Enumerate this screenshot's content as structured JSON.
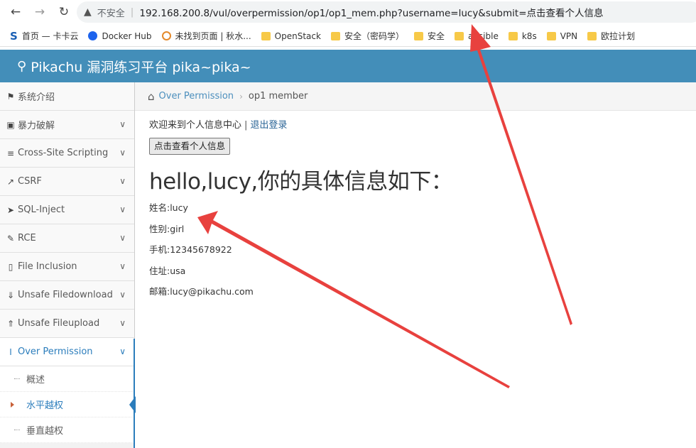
{
  "browser": {
    "insecure_label": "不安全",
    "url": "192.168.200.8/vul/overpermission/op1/op1_mem.php?username=lucy&submit=点击查看个人信息",
    "bookmarks": [
      {
        "label": "首页 — 卡卡云",
        "icon": "s-logo-icon"
      },
      {
        "label": "Docker Hub",
        "icon": "docker-icon"
      },
      {
        "label": "未找到页面 | 秋水...",
        "icon": "ring-icon"
      },
      {
        "label": "OpenStack",
        "icon": "folder-icon"
      },
      {
        "label": "安全（密码学）",
        "icon": "folder-icon"
      },
      {
        "label": "安全",
        "icon": "folder-icon"
      },
      {
        "label": "ansible",
        "icon": "folder-icon"
      },
      {
        "label": "k8s",
        "icon": "folder-icon"
      },
      {
        "label": "VPN",
        "icon": "folder-icon"
      },
      {
        "label": "欧拉计划",
        "icon": "folder-icon"
      }
    ]
  },
  "header": {
    "title": "Pikachu 漏洞练习平台 pika~pika~"
  },
  "sidebar": {
    "items": [
      {
        "label": "系统介绍",
        "icon": "tag-icon",
        "has_chevron": false
      },
      {
        "label": "暴力破解",
        "icon": "lock-icon",
        "has_chevron": true
      },
      {
        "label": "Cross-Site Scripting",
        "icon": "code-icon",
        "has_chevron": true
      },
      {
        "label": "CSRF",
        "icon": "share-icon",
        "has_chevron": true
      },
      {
        "label": "SQL-Inject",
        "icon": "plane-icon",
        "has_chevron": true
      },
      {
        "label": "RCE",
        "icon": "pencil-icon",
        "has_chevron": true
      },
      {
        "label": "File Inclusion",
        "icon": "file-icon",
        "has_chevron": true
      },
      {
        "label": "Unsafe Filedownload",
        "icon": "download-icon",
        "has_chevron": true
      },
      {
        "label": "Unsafe Fileupload",
        "icon": "upload-icon",
        "has_chevron": true
      },
      {
        "label": "Over Permission",
        "icon": "text-cursor-icon",
        "has_chevron": true
      }
    ],
    "sub_items": [
      {
        "label": "概述"
      },
      {
        "label": "水平越权"
      },
      {
        "label": "垂直越权"
      }
    ]
  },
  "breadcrumb": {
    "parent": "Over Permission",
    "current": "op1 member"
  },
  "main": {
    "welcome_text": "欢迎来到个人信息中心",
    "logout_label": "退出登录",
    "view_button": "点击查看个人信息",
    "greeting": "hello,lucy,你的具体信息如下：",
    "info": [
      "姓名:lucy",
      "性别:girl",
      "手机:12345678922",
      "住址:usa",
      "邮箱:lucy@pikachu.com"
    ]
  },
  "colors": {
    "header_bg": "#438eb9",
    "accent": "#2b7dbc",
    "arrow": "#e8413e"
  }
}
